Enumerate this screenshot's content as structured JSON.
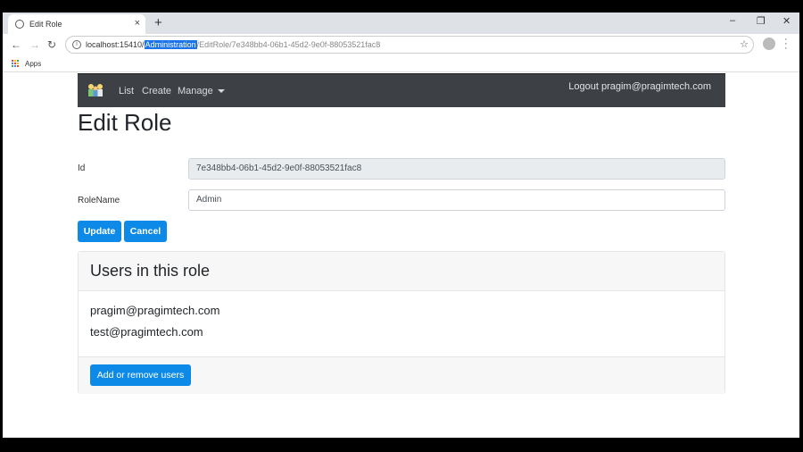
{
  "browser": {
    "tab_title": "Edit Role",
    "tab_close": "×",
    "new_tab": "+",
    "window_controls": {
      "minimize": "–",
      "maximize": "❐",
      "close": "✕"
    },
    "url_host": "localhost:15410/",
    "url_selected": "Administration",
    "url_rest": "/EditRole/7e348bb4-06b1-45d2-9e0f-88053521fac8",
    "bookmarks_apps": "Apps"
  },
  "navbar": {
    "links": [
      "List",
      "Create",
      "Manage"
    ],
    "logout": "Logout pragim@pragimtech.com"
  },
  "page": {
    "title": "Edit Role",
    "id_label": "Id",
    "id_value": "7e348bb4-06b1-45d2-9e0f-88053521fac8",
    "rolename_label": "RoleName",
    "rolename_value": "Admin",
    "update_button": "Update",
    "cancel_button": "Cancel"
  },
  "users_card": {
    "title": "Users in this role",
    "users": [
      "pragim@pragimtech.com",
      "test@pragimtech.com"
    ],
    "add_remove_button": "Add or remove users"
  },
  "colors": {
    "primary": "#0d8ae8",
    "navbar": "#3d4146",
    "selection": "#1a73e8"
  }
}
